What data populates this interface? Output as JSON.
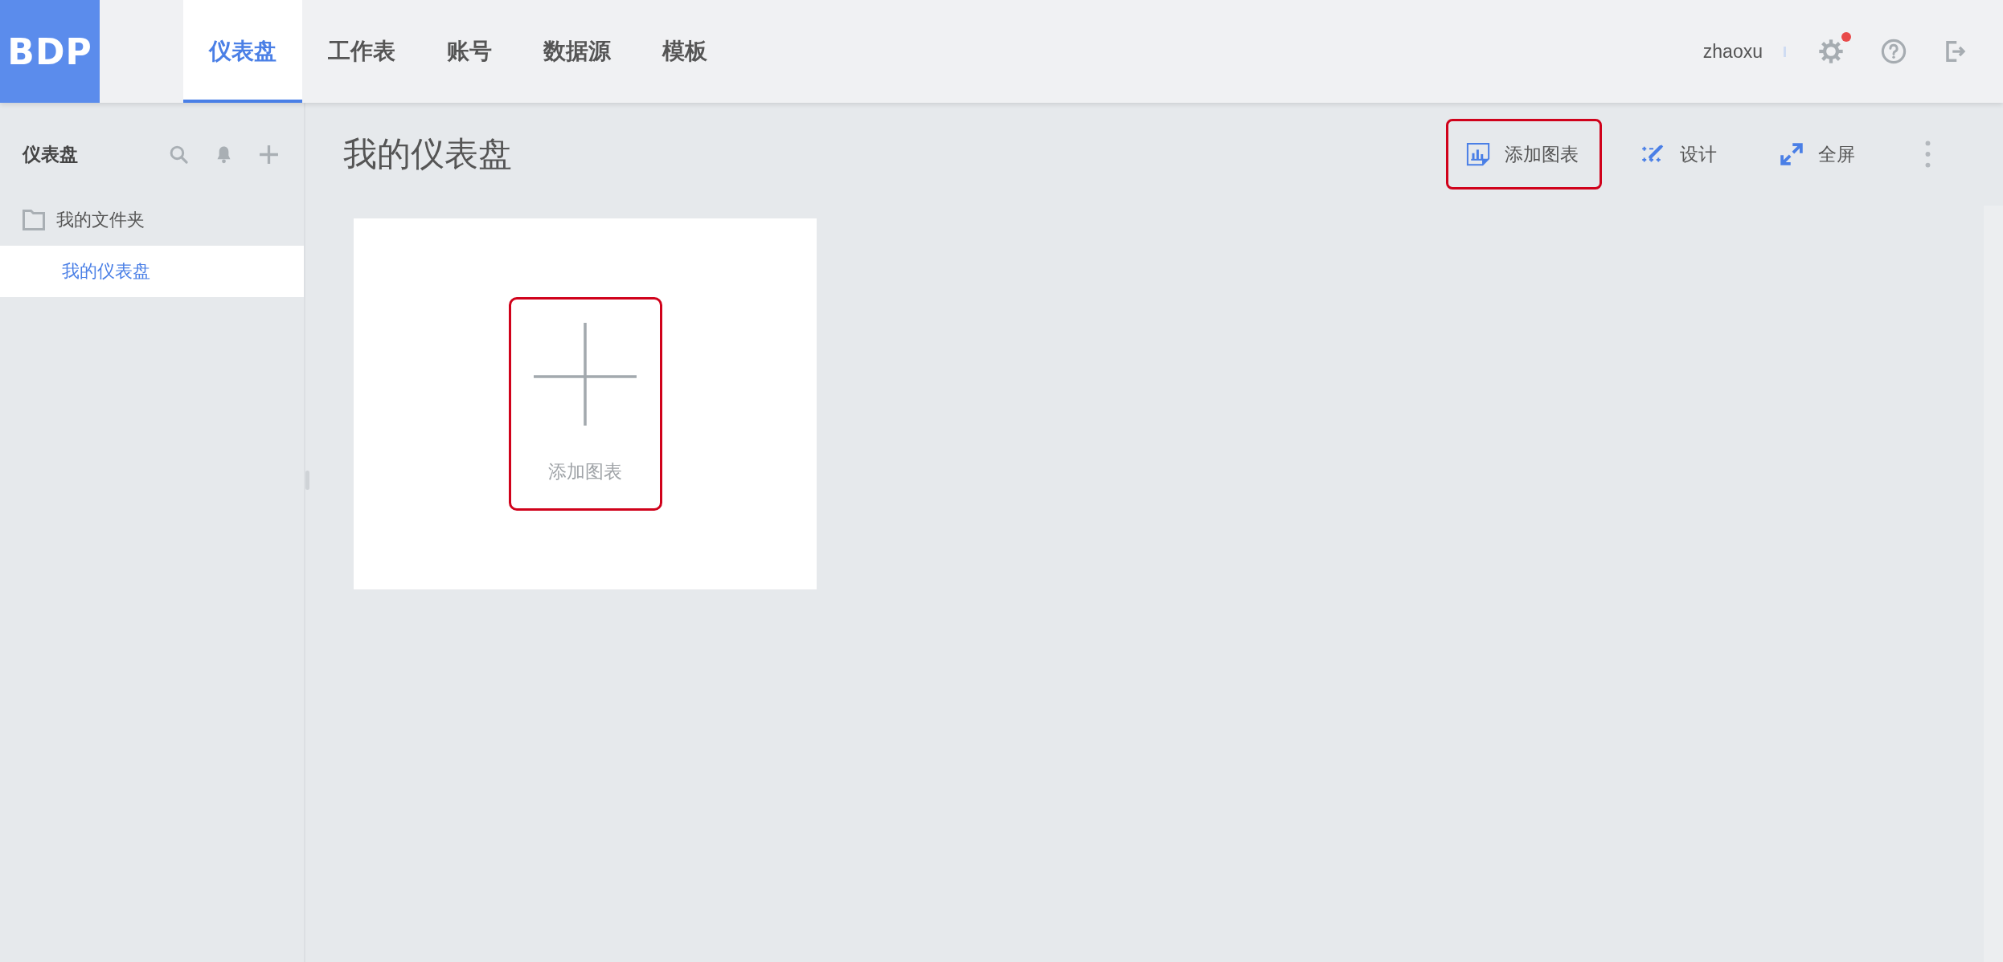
{
  "header": {
    "logo": "BDP",
    "tabs": [
      {
        "label": "仪表盘",
        "selected": true
      },
      {
        "label": "工作表",
        "selected": false
      },
      {
        "label": "账号",
        "selected": false
      },
      {
        "label": "数据源",
        "selected": false
      },
      {
        "label": "模板",
        "selected": false
      }
    ],
    "user": "zhaoxu",
    "settings": {
      "notification": true
    }
  },
  "sidebar": {
    "title": "仪表盘",
    "tree": [
      {
        "label": "我的文件夹",
        "kind": "folder",
        "selected": false,
        "children": [
          {
            "label": "我的仪表盘",
            "selected": true
          }
        ]
      }
    ]
  },
  "main": {
    "title": "我的仪表盘",
    "toolbar": [
      {
        "label": "添加图表",
        "kind": "chart",
        "highlighted": true
      },
      {
        "label": "设计",
        "kind": "design",
        "highlighted": false
      },
      {
        "label": "全屏",
        "kind": "fullscreen",
        "highlighted": false
      }
    ],
    "add_tile": {
      "label": "添加图表",
      "highlighted": true
    }
  }
}
